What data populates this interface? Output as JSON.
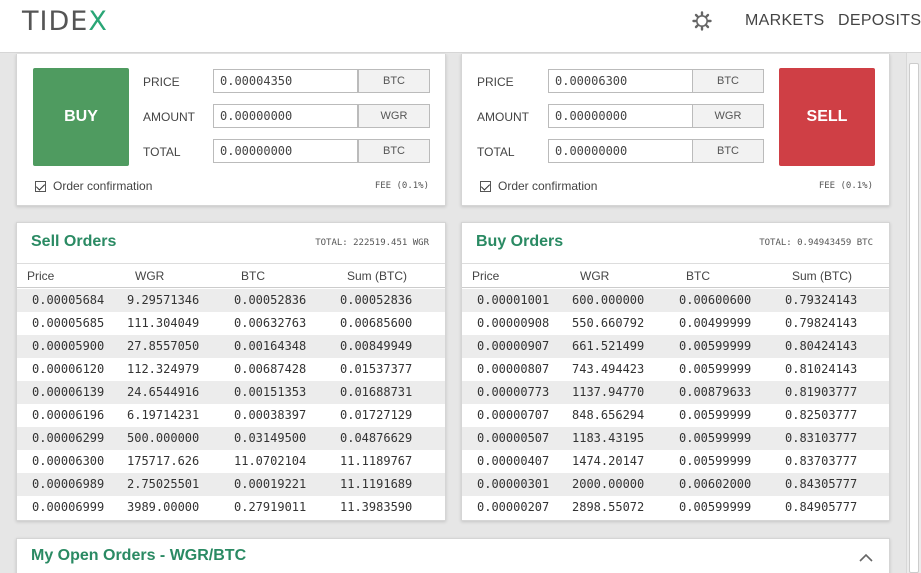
{
  "header": {
    "logo_prefix": "TIDE",
    "logo_x": "X",
    "nav": [
      "MARKETS",
      "DEPOSITS AND"
    ]
  },
  "buy_form": {
    "button_label": "BUY",
    "price_label": "PRICE",
    "price_value": "0.00004350",
    "price_unit": "BTC",
    "amount_label": "AMOUNT",
    "amount_value": "0.00000000",
    "amount_unit": "WGR",
    "total_label": "TOTAL",
    "total_value": "0.00000000",
    "total_unit": "BTC",
    "confirm_label": "Order confirmation",
    "fee": "FEE (0.1%)"
  },
  "sell_form": {
    "button_label": "SELL",
    "price_label": "PRICE",
    "price_value": "0.00006300",
    "price_unit": "BTC",
    "amount_label": "AMOUNT",
    "amount_value": "0.00000000",
    "amount_unit": "WGR",
    "total_label": "TOTAL",
    "total_value": "0.00000000",
    "total_unit": "BTC",
    "confirm_label": "Order confirmation",
    "fee": "FEE (0.1%)"
  },
  "sell_orders": {
    "title": "Sell Orders",
    "total": "TOTAL: 222519.451 WGR",
    "columns": [
      "Price",
      "WGR",
      "BTC",
      "Sum (BTC)"
    ],
    "rows": [
      [
        "0.00005684",
        "9.29571346",
        "0.00052836",
        "0.00052836"
      ],
      [
        "0.00005685",
        "111.304049",
        "0.00632763",
        "0.00685600"
      ],
      [
        "0.00005900",
        "27.8557050",
        "0.00164348",
        "0.00849949"
      ],
      [
        "0.00006120",
        "112.324979",
        "0.00687428",
        "0.01537377"
      ],
      [
        "0.00006139",
        "24.6544916",
        "0.00151353",
        "0.01688731"
      ],
      [
        "0.00006196",
        "6.19714231",
        "0.00038397",
        "0.01727129"
      ],
      [
        "0.00006299",
        "500.000000",
        "0.03149500",
        "0.04876629"
      ],
      [
        "0.00006300",
        "175717.626",
        "11.0702104",
        "11.1189767"
      ],
      [
        "0.00006989",
        "2.75025501",
        "0.00019221",
        "11.1191689"
      ],
      [
        "0.00006999",
        "3989.00000",
        "0.27919011",
        "11.3983590"
      ]
    ]
  },
  "buy_orders": {
    "title": "Buy Orders",
    "total": "TOTAL: 0.94943459 BTC",
    "columns": [
      "Price",
      "WGR",
      "BTC",
      "Sum (BTC)"
    ],
    "rows": [
      [
        "0.00001001",
        "600.000000",
        "0.00600600",
        "0.79324143"
      ],
      [
        "0.00000908",
        "550.660792",
        "0.00499999",
        "0.79824143"
      ],
      [
        "0.00000907",
        "661.521499",
        "0.00599999",
        "0.80424143"
      ],
      [
        "0.00000807",
        "743.494423",
        "0.00599999",
        "0.81024143"
      ],
      [
        "0.00000773",
        "1137.94770",
        "0.00879633",
        "0.81903777"
      ],
      [
        "0.00000707",
        "848.656294",
        "0.00599999",
        "0.82503777"
      ],
      [
        "0.00000507",
        "1183.43195",
        "0.00599999",
        "0.83103777"
      ],
      [
        "0.00000407",
        "1474.20147",
        "0.00599999",
        "0.83703777"
      ],
      [
        "0.00000301",
        "2000.00000",
        "0.00602000",
        "0.84305777"
      ],
      [
        "0.00000207",
        "2898.55072",
        "0.00599999",
        "0.84905777"
      ]
    ]
  },
  "open_orders": {
    "title": "My Open Orders - WGR/BTC"
  },
  "icons": [
    "gear-icon",
    "checkbox-icon",
    "chevron-up-icon"
  ],
  "colors": {
    "accent": "#2a8a63",
    "buy": "#4f9b60",
    "sell": "#cf3f45"
  }
}
